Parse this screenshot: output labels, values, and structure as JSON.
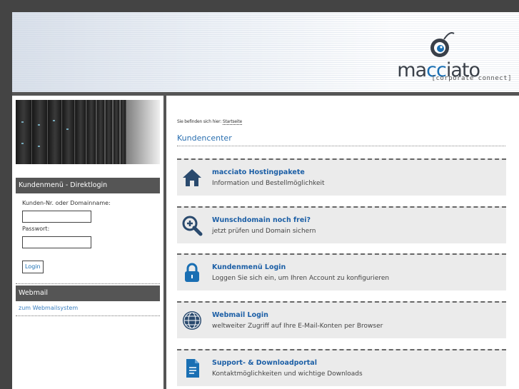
{
  "brand": {
    "logo_prefix": "ma",
    "logo_accent": "cc",
    "logo_suffix": "iato",
    "tagline": "[corporate connect]",
    "accent_color": "#1a6fb3",
    "dark_color": "#3a4049"
  },
  "sidebar": {
    "login_heading": "Kundenmenü - Direktlogin",
    "customer_label": "Kunden-Nr. oder Domainname:",
    "customer_value": "",
    "password_label": "Passwort:",
    "password_value": "",
    "login_button": "Login",
    "webmail_heading": "Webmail",
    "webmail_link": "zum Webmailsystem"
  },
  "main": {
    "breadcrumb_prefix": "Sie befinden sich hier:",
    "breadcrumb_link": "Startseite",
    "title": "Kundencenter",
    "cards": [
      {
        "title": "macciato Hostingpakete",
        "desc": "Information und Bestellmöglichkeit",
        "icon": "home-icon"
      },
      {
        "title": "Wunschdomain noch frei?",
        "desc": "jetzt prüfen und Domain sichern",
        "icon": "zoom-in-icon"
      },
      {
        "title": "Kundenmenü Login",
        "desc": "Loggen Sie sich ein, um Ihren Account zu konfigurieren",
        "icon": "lock-icon"
      },
      {
        "title": "Webmail Login",
        "desc": "weltweiter Zugriff auf Ihre E-Mail-Konten per Browser",
        "icon": "globe-icon"
      },
      {
        "title": "Support- & Downloadportal",
        "desc": "Kontaktmöglichkeiten und wichtige Downloads",
        "icon": "document-icon"
      }
    ]
  }
}
